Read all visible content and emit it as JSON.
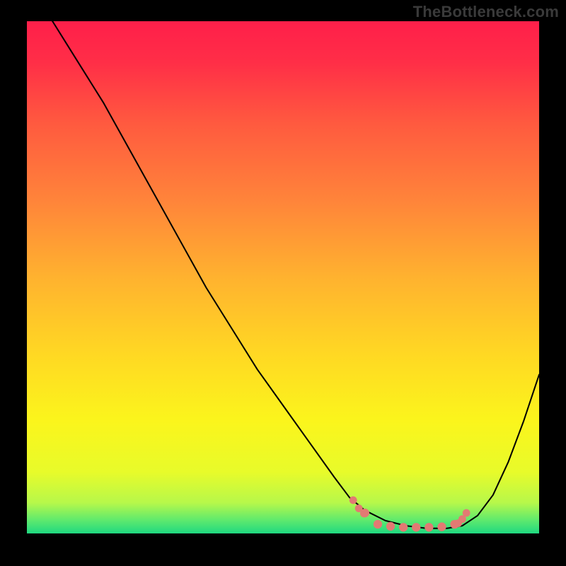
{
  "watermark": "TheBottleneck.com",
  "colors": {
    "curve_stroke": "#000000",
    "marker_fill": "#e27a73",
    "bg_black": "#000000",
    "gradient_stops": [
      {
        "offset": 0.0,
        "color": "#ff1f4a"
      },
      {
        "offset": 0.08,
        "color": "#ff2e47"
      },
      {
        "offset": 0.2,
        "color": "#ff5a3f"
      },
      {
        "offset": 0.35,
        "color": "#ff843a"
      },
      {
        "offset": 0.5,
        "color": "#ffb22f"
      },
      {
        "offset": 0.65,
        "color": "#ffd823"
      },
      {
        "offset": 0.78,
        "color": "#fbf51c"
      },
      {
        "offset": 0.88,
        "color": "#e8fb2a"
      },
      {
        "offset": 0.94,
        "color": "#b7f84a"
      },
      {
        "offset": 0.975,
        "color": "#5ce96e"
      },
      {
        "offset": 1.0,
        "color": "#1fd880"
      }
    ]
  },
  "chart_data": {
    "type": "line",
    "title": "",
    "xlabel": "",
    "ylabel": "",
    "xlim": [
      0,
      1
    ],
    "ylim": [
      0,
      1
    ],
    "series": [
      {
        "name": "bottleneck-curve",
        "x": [
          0.0,
          0.05,
          0.1,
          0.15,
          0.2,
          0.25,
          0.3,
          0.35,
          0.4,
          0.45,
          0.5,
          0.55,
          0.6,
          0.63,
          0.66,
          0.7,
          0.74,
          0.78,
          0.82,
          0.85,
          0.88,
          0.91,
          0.94,
          0.97,
          1.0
        ],
        "y": [
          1.06,
          1.0,
          0.92,
          0.84,
          0.75,
          0.66,
          0.57,
          0.48,
          0.4,
          0.32,
          0.25,
          0.18,
          0.11,
          0.07,
          0.045,
          0.025,
          0.015,
          0.01,
          0.01,
          0.015,
          0.035,
          0.075,
          0.14,
          0.22,
          0.31
        ]
      }
    ],
    "markers_flat": {
      "x": [
        0.66,
        0.685,
        0.71,
        0.735,
        0.76,
        0.785,
        0.81,
        0.835
      ],
      "y": [
        0.04,
        0.018,
        0.014,
        0.012,
        0.012,
        0.012,
        0.013,
        0.018
      ]
    },
    "markers_end": {
      "x": [
        0.637,
        0.648,
        0.658,
        0.842,
        0.85,
        0.858
      ],
      "y": [
        0.065,
        0.049,
        0.039,
        0.02,
        0.028,
        0.04
      ]
    }
  }
}
